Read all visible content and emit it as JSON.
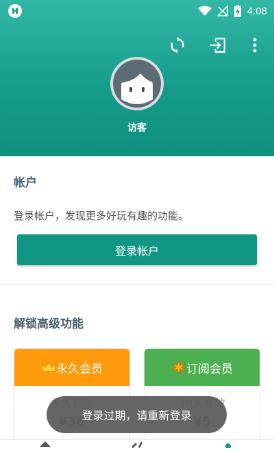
{
  "status": {
    "time": "4:08"
  },
  "profile": {
    "username": "访客"
  },
  "account": {
    "title": "帐户",
    "description": "登录帐户，发现更多好玩有趣的功能。",
    "login_label": "登录帐户"
  },
  "premium": {
    "title": "解锁高级功能",
    "plans": [
      {
        "icon": "crown-icon",
        "name": "永久会员",
        "validity": "永久有效",
        "price": "¥36",
        "color": "#ff9a0c"
      },
      {
        "icon": "spark-icon",
        "name": "订阅会员",
        "validity": "30天有效",
        "price": "¥5",
        "color": "#4caf50"
      }
    ]
  },
  "toast": {
    "message": "登录过期，请重新登录"
  },
  "colors": {
    "primary": "#119683",
    "header": "#169c8b"
  }
}
